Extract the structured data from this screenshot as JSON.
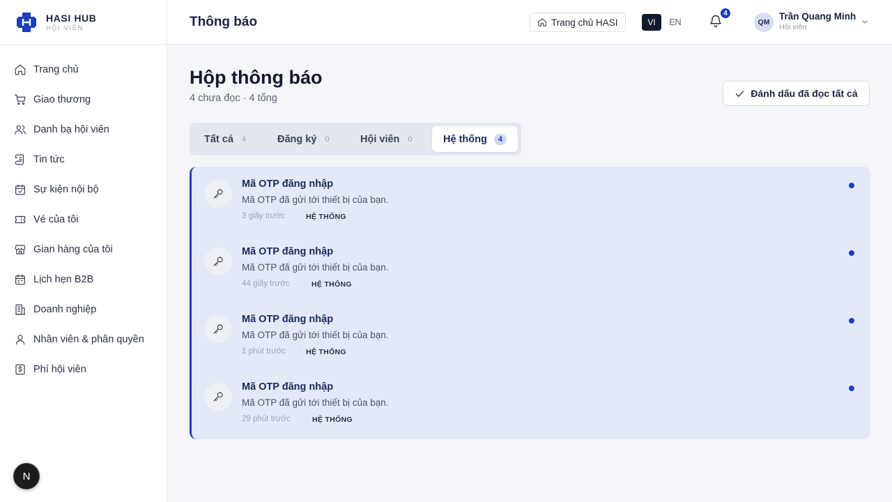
{
  "brand": {
    "name": "HASI HUB",
    "sub": "HỘI VIÊN"
  },
  "sidebar": {
    "items": [
      {
        "label": "Trang chủ",
        "icon": "home-icon"
      },
      {
        "label": "Giao thương",
        "icon": "cart-icon"
      },
      {
        "label": "Danh bạ hội viên",
        "icon": "users-icon"
      },
      {
        "label": "Tin tức",
        "icon": "scroll-icon"
      },
      {
        "label": "Sự kiện nội bộ",
        "icon": "calendar-check-icon"
      },
      {
        "label": "Vé của tôi",
        "icon": "ticket-icon"
      },
      {
        "label": "Gian hàng của tôi",
        "icon": "store-icon"
      },
      {
        "label": "Lịch hẹn B2B",
        "icon": "calendar-icon"
      },
      {
        "label": "Doanh nghiệp",
        "icon": "building-icon"
      },
      {
        "label": "Nhân viên & phân quyền",
        "icon": "user-icon"
      },
      {
        "label": "Phí hội viên",
        "icon": "receipt-icon"
      }
    ],
    "dev_badge": "N"
  },
  "header": {
    "title": "Thông báo",
    "home_button": "Trang chủ HASI",
    "lang_vi": "VI",
    "lang_en": "EN",
    "bell_count": "4",
    "user_initials": "QM",
    "user_name": "Trần Quang Minh",
    "user_role": "Hội viên"
  },
  "main": {
    "title": "Hộp thông báo",
    "subtitle": "4 chưa đọc · 4 tổng",
    "mark_all": "Đánh dấu đã đọc tất cả",
    "tabs": [
      {
        "label": "Tất cả",
        "count": "4"
      },
      {
        "label": "Đăng ký",
        "count": "0"
      },
      {
        "label": "Hội viên",
        "count": "0"
      },
      {
        "label": "Hệ thống",
        "count": "4",
        "active": true
      }
    ],
    "notifications": [
      {
        "title": "Mã OTP đăng nhập",
        "body": "Mã OTP đã gửi tới thiết bị của bạn.",
        "time": "3 giây trước",
        "sep": "·",
        "tag": "HỆ THỐNG",
        "unread": true
      },
      {
        "title": "Mã OTP đăng nhập",
        "body": "Mã OTP đã gửi tới thiết bị của bạn.",
        "time": "44 giây trước",
        "sep": "·",
        "tag": "HỆ THỐNG",
        "unread": true
      },
      {
        "title": "Mã OTP đăng nhập",
        "body": "Mã OTP đã gửi tới thiết bị của bạn.",
        "time": "1 phút trước",
        "sep": "·",
        "tag": "HỆ THỐNG",
        "unread": true
      },
      {
        "title": "Mã OTP đăng nhập",
        "body": "Mã OTP đã gửi tới thiết bị của bạn.",
        "time": "29 phút trước",
        "sep": "·",
        "tag": "HỆ THỐNG",
        "unread": true
      }
    ]
  },
  "colors": {
    "accent": "#1d3fbf",
    "dark": "#121a2e",
    "unread_bg": "#e3e9f6"
  }
}
